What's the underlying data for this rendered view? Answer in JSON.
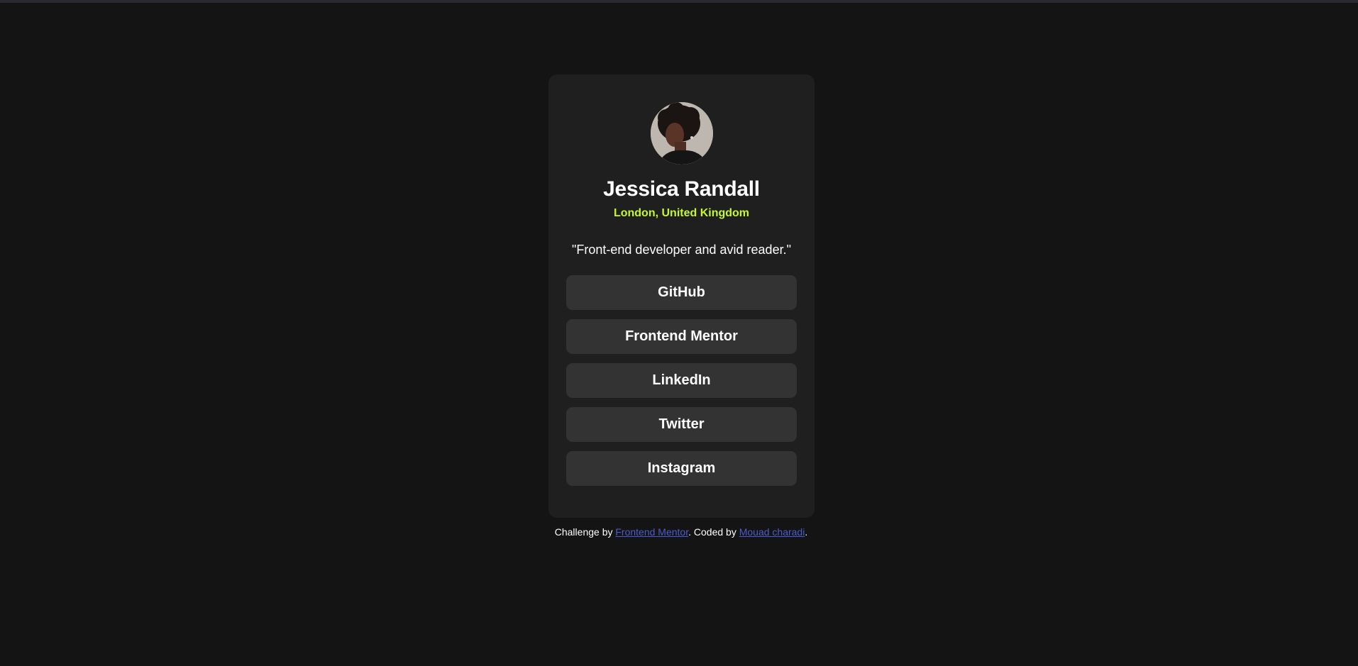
{
  "profile": {
    "name": "Jessica Randall",
    "location": "London, United Kingdom",
    "bio": "\"Front-end developer and avid reader.\""
  },
  "links": [
    {
      "label": "GitHub"
    },
    {
      "label": "Frontend Mentor"
    },
    {
      "label": "LinkedIn"
    },
    {
      "label": "Twitter"
    },
    {
      "label": "Instagram"
    }
  ],
  "attribution": {
    "prefix": "Challenge by ",
    "challenge_link": "Frontend Mentor",
    "middle": ". Coded by ",
    "author_link": "Mouad charadi",
    "suffix": "."
  },
  "colors": {
    "background": "#141414",
    "card": "#1f1f1f",
    "button": "#333333",
    "accent": "#c4f82a",
    "link": "#4a5bd0"
  }
}
